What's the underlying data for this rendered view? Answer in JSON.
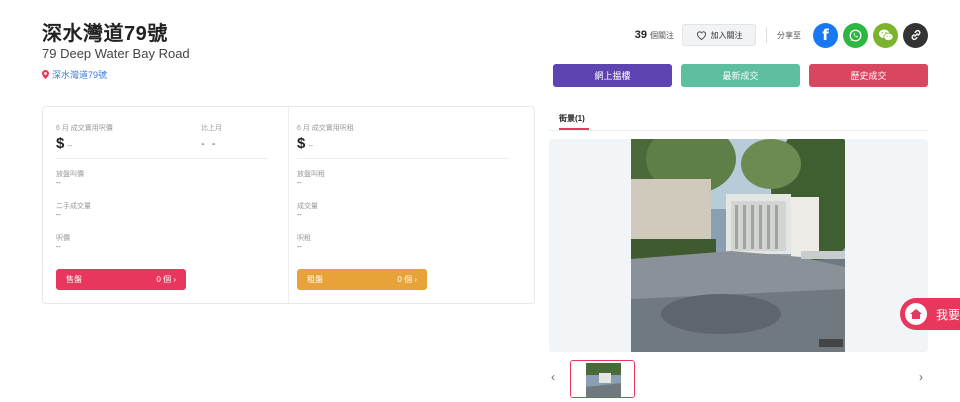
{
  "property": {
    "title": "深水灣道79號",
    "subtitle": "79 Deep Water Bay Road",
    "location": "深水灣道79號"
  },
  "header": {
    "follow_count": "39",
    "follow_label": "個關注",
    "follow_button": "加入關注",
    "share_label": "分享至",
    "share_icons": [
      "facebook-icon",
      "whatsapp-icon",
      "wechat-icon",
      "link-icon"
    ]
  },
  "actions": [
    {
      "label": "網上揾樓",
      "color": "#5e44b0"
    },
    {
      "label": "最新成交",
      "color": "#5dbea0"
    },
    {
      "label": "歷史成交",
      "color": "#d94660"
    }
  ],
  "sale": {
    "month_label": "6 月 成交實用呎價",
    "price_value": "--",
    "change_label": "比上月",
    "change_value": "- -",
    "listing_price_label": "放盤叫價",
    "listing_price_value": "--",
    "secondary_label": "二手成交量",
    "secondary_value": "--",
    "psf_label": "呎價",
    "psf_value": "--",
    "button_label": "售盤",
    "button_count": "0 個"
  },
  "rent": {
    "month_label": "6 月 成交實用呎租",
    "price_value": "--",
    "listing_rent_label": "放盤叫租",
    "listing_rent_value": "--",
    "volume_label": "成交量",
    "volume_value": "--",
    "psf_label": "呎租",
    "psf_value": "--",
    "button_label": "租盤",
    "button_count": "0 個"
  },
  "gallery": {
    "tab_label": "街景(1)",
    "prev_label": "‹",
    "next_label": "›"
  },
  "float_button": {
    "label": "我要"
  },
  "colors": {
    "accent": "#e8365c",
    "rent": "#e7a23a",
    "link": "#3a7bd5"
  }
}
